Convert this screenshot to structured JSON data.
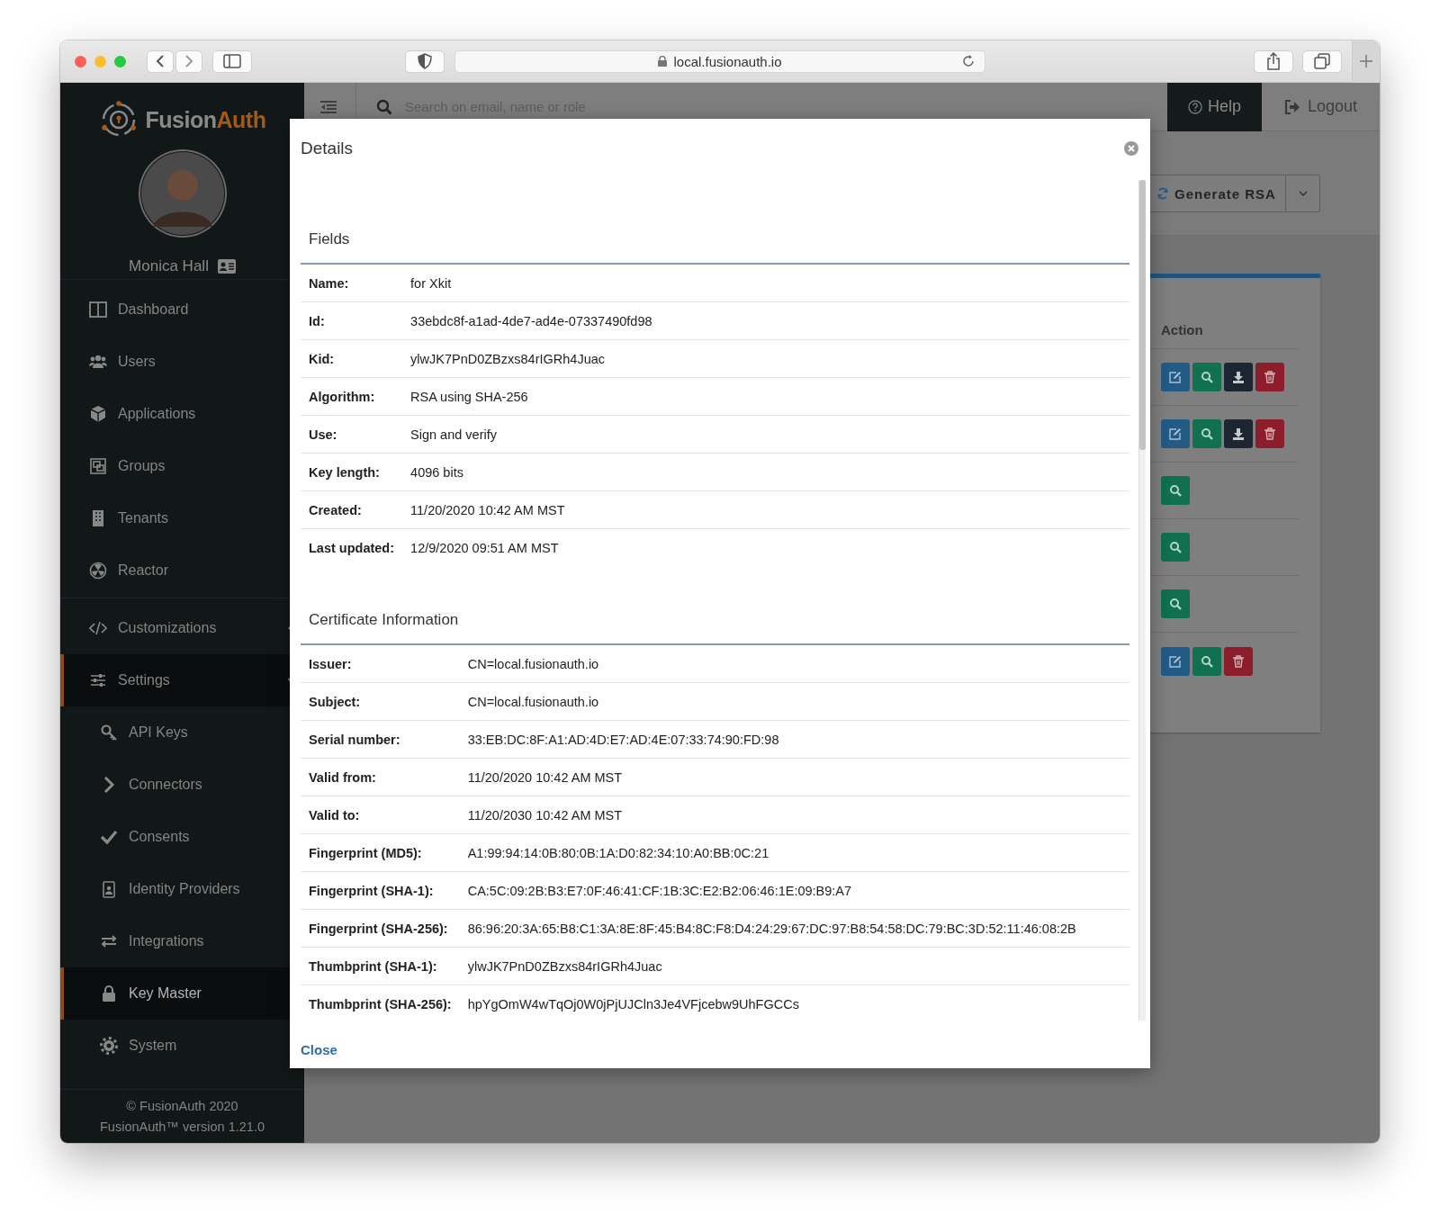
{
  "browser": {
    "url": "local.fusionauth.io"
  },
  "sidebar": {
    "brand": {
      "first": "Fusion",
      "second": "Auth"
    },
    "user_name": "Monica Hall",
    "groups": [
      [
        {
          "label": "Dashboard",
          "selected": false
        },
        {
          "label": "Users",
          "selected": false
        },
        {
          "label": "Applications",
          "selected": false
        },
        {
          "label": "Groups",
          "selected": false
        },
        {
          "label": "Tenants",
          "selected": false
        },
        {
          "label": "Reactor",
          "selected": false
        }
      ],
      [
        {
          "label": "Customizations",
          "selected": false,
          "expanded": false
        },
        {
          "label": "Settings",
          "selected": false,
          "expanded": true,
          "children": [
            {
              "label": "API Keys",
              "selected": false
            },
            {
              "label": "Connectors",
              "selected": false
            },
            {
              "label": "Consents",
              "selected": false
            },
            {
              "label": "Identity Providers",
              "selected": false
            },
            {
              "label": "Integrations",
              "selected": false
            },
            {
              "label": "Key Master",
              "selected": true
            },
            {
              "label": "System",
              "selected": false
            }
          ]
        }
      ]
    ],
    "footer": [
      "© FusionAuth 2020",
      "FusionAuth™ version 1.21.0"
    ]
  },
  "topbar": {
    "search_placeholder": "Search on email, name or role",
    "help": "Help",
    "logout": "Logout"
  },
  "toolbar": {
    "generate_button": "Generate RSA"
  },
  "table": {
    "column": "Action",
    "rows": [
      {
        "actions": [
          {
            "kind": "edit"
          },
          {
            "kind": "view"
          },
          {
            "kind": "download"
          },
          {
            "kind": "delete"
          }
        ]
      },
      {
        "actions": [
          {
            "kind": "edit"
          },
          {
            "kind": "view"
          },
          {
            "kind": "download"
          },
          {
            "kind": "delete"
          }
        ]
      },
      {
        "actions": [
          {
            "kind": "view"
          }
        ]
      },
      {
        "actions": [
          {
            "kind": "view"
          }
        ]
      },
      {
        "actions": [
          {
            "kind": "view"
          }
        ]
      },
      {
        "actions": [
          {
            "kind": "edit"
          },
          {
            "kind": "view"
          },
          {
            "kind": "delete"
          }
        ]
      }
    ]
  },
  "modal": {
    "title": "Details",
    "sections": [
      {
        "title": "Fields",
        "rows": [
          {
            "label": "Name:",
            "value": "for Xkit"
          },
          {
            "label": "Id:",
            "value": "33ebdc8f-a1ad-4de7-ad4e-07337490fd98"
          },
          {
            "label": "Kid:",
            "value": "ylwJK7PnD0ZBzxs84rIGRh4Juac"
          },
          {
            "label": "Algorithm:",
            "value": "RSA using SHA-256"
          },
          {
            "label": "Use:",
            "value": "Sign and verify"
          },
          {
            "label": "Key length:",
            "value": "4096 bits"
          },
          {
            "label": "Created:",
            "value": "11/20/2020 10:42 AM MST"
          },
          {
            "label": "Last updated:",
            "value": "12/9/2020 09:51 AM MST"
          }
        ]
      },
      {
        "title": "Certificate Information",
        "rows": [
          {
            "label": "Issuer:",
            "value": "CN=local.fusionauth.io"
          },
          {
            "label": "Subject:",
            "value": "CN=local.fusionauth.io"
          },
          {
            "label": "Serial number:",
            "value": "33:EB:DC:8F:A1:AD:4D:E7:AD:4E:07:33:74:90:FD:98"
          },
          {
            "label": "Valid from:",
            "value": "11/20/2020 10:42 AM MST"
          },
          {
            "label": "Valid to:",
            "value": "11/20/2030 10:42 AM MST"
          },
          {
            "label": "Fingerprint (MD5):",
            "value": "A1:99:94:14:0B:80:0B:1A:D0:82:34:10:A0:BB:0C:21"
          },
          {
            "label": "Fingerprint (SHA-1):",
            "value": "CA:5C:09:2B:B3:E7:0F:46:41:CF:1B:3C:E2:B2:06:46:1E:09:B9:A7"
          },
          {
            "label": "Fingerprint (SHA-256):",
            "value": "86:96:20:3A:65:B8:C1:3A:8E:8F:45:B4:8C:F8:D4:24:29:67:DC:97:B8:54:58:DC:79:BC:3D:52:11:46:08:2B"
          },
          {
            "label": "Thumbprint (SHA-1):",
            "value": "ylwJK7PnD0ZBzxs84rIGRh4Juac"
          },
          {
            "label": "Thumbprint (SHA-256):",
            "value": "hpYgOmW4wTqOj0W0jPjUJCln3Je4VFjcebw9UhFGCCs"
          }
        ]
      }
    ],
    "close_link": "Close"
  }
}
